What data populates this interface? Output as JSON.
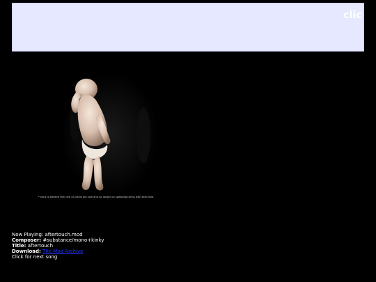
{
  "banner": {
    "text": "clic"
  },
  "image": {
    "icon": "dancing-baby-image",
    "caption": "* hard to believe they are 40 years old now and no longer on speaking terms with their kids"
  },
  "player": {
    "now_playing_label": "Now Playing:",
    "now_playing_value": "aftertouch.mod",
    "composer_label": "Composer:",
    "composer_value": "#substance/mono+kinky",
    "title_label": "Title:",
    "title_value": "aftertouch",
    "download_label": "Download:",
    "download_value": "The Mod Archive",
    "next_text": "Click for next song"
  },
  "colors": {
    "background": "#000000",
    "banner": "#e6e8ff",
    "link": "#2233ff",
    "text": "#ffffff"
  }
}
